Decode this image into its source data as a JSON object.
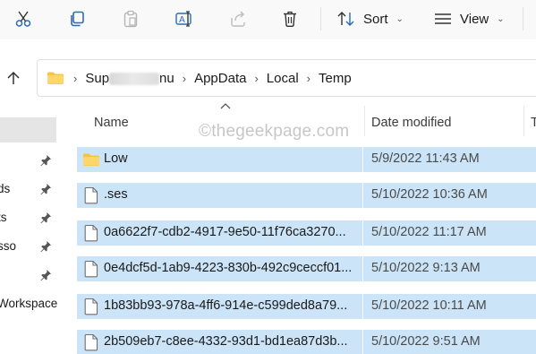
{
  "toolbar": {
    "cut_icon": "scissors-icon",
    "copy_icon": "copy-icon",
    "paste_icon": "paste-icon",
    "rename_icon": "rename-icon",
    "share_icon": "share-icon",
    "delete_icon": "trash-icon",
    "sort_label": "Sort",
    "view_label": "View"
  },
  "address": {
    "crumbs": [
      "Sup",
      "nu",
      "AppData",
      "Local",
      "Temp"
    ]
  },
  "nav": {
    "items": [
      {
        "label": "ds"
      },
      {
        "label": "ts"
      },
      {
        "label": "sso"
      },
      {
        "label": ""
      },
      {
        "label": "Workspace"
      }
    ]
  },
  "columns": {
    "name": "Name",
    "date_modified": "Date modified",
    "type": "T"
  },
  "watermark": "©thegeekpage.com",
  "files": [
    {
      "name": "Low",
      "date": "5/9/2022 11:43 AM",
      "kind": "folder"
    },
    {
      "name": ".ses",
      "date": "5/10/2022 10:36 AM",
      "kind": "file"
    },
    {
      "name": "0a6622f7-cdb2-4917-9e50-11f76ca3270...",
      "date": "5/10/2022 11:17 AM",
      "kind": "file"
    },
    {
      "name": "0e4dcf5d-1ab9-4223-830b-492c9ceccf01...",
      "date": "5/10/2022 9:13 AM",
      "kind": "file"
    },
    {
      "name": "1b83bb93-978a-4ff6-914e-c599ded8a79...",
      "date": "5/10/2022 10:11 AM",
      "kind": "file"
    },
    {
      "name": "2b509eb7-c8ee-4332-93d1-bd1ea87d3b...",
      "date": "5/10/2022 9:51 AM",
      "kind": "file"
    }
  ]
}
